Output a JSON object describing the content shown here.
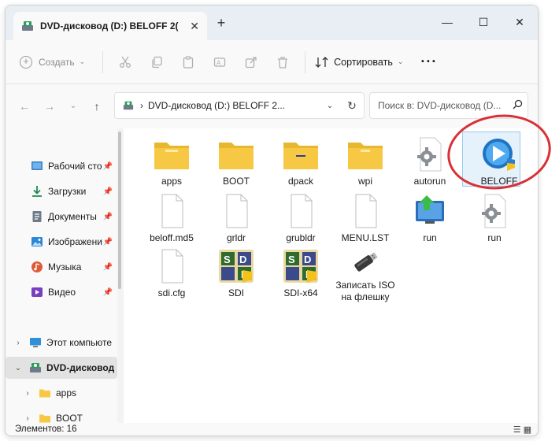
{
  "window": {
    "tab_title": "DVD-дисковод (D:) BELOFF 2(",
    "tab_close": "✕",
    "new_tab": "+",
    "minimize": "—",
    "maximize": "☐",
    "close": "✕"
  },
  "toolbar": {
    "create_label": "Создать",
    "sort_label": "Сортировать",
    "more_label": "···"
  },
  "address": {
    "path": "DVD-дисковод (D:) BELOFF 2...",
    "search_placeholder": "Поиск в: DVD-дисковод (D..."
  },
  "sidebar": {
    "items": [
      {
        "label": "Рабочий сто",
        "icon": "desktop-icon"
      },
      {
        "label": "Загрузки",
        "icon": "downloads-icon"
      },
      {
        "label": "Документы",
        "icon": "documents-icon"
      },
      {
        "label": "Изображени",
        "icon": "pictures-icon"
      },
      {
        "label": "Музыка",
        "icon": "music-icon"
      },
      {
        "label": "Видео",
        "icon": "videos-icon"
      },
      {
        "label": "Этот компьюте",
        "icon": "computer-icon"
      },
      {
        "label": "DVD-дисковод (",
        "icon": "dvd-drive-icon"
      },
      {
        "label": "apps",
        "icon": "folder-icon"
      },
      {
        "label": "BOOT",
        "icon": "folder-icon"
      }
    ]
  },
  "files": [
    {
      "name": "apps",
      "type": "folder"
    },
    {
      "name": "BOOT",
      "type": "folder"
    },
    {
      "name": "dpack",
      "type": "folder"
    },
    {
      "name": "wpi",
      "type": "folder"
    },
    {
      "name": "autorun",
      "type": "settings-file"
    },
    {
      "name": "BELOFF",
      "type": "beloff-app"
    },
    {
      "name": "beloff.md5",
      "type": "file"
    },
    {
      "name": "grldr",
      "type": "file"
    },
    {
      "name": "grubldr",
      "type": "file"
    },
    {
      "name": "MENU.LST",
      "type": "file"
    },
    {
      "name": "run",
      "type": "run-app"
    },
    {
      "name": "run",
      "type": "settings-file"
    },
    {
      "name": "sdi.cfg",
      "type": "file"
    },
    {
      "name": "SDI",
      "type": "sdi-app"
    },
    {
      "name": "SDI-x64",
      "type": "sdi-app"
    },
    {
      "name": "Записать ISO на флешку",
      "type": "usb-app"
    }
  ],
  "status": {
    "count_text": "Элементов: 16"
  },
  "colors": {
    "folder": "#f7c843",
    "annotation": "#d93036",
    "selection": "#e5f1fb"
  }
}
